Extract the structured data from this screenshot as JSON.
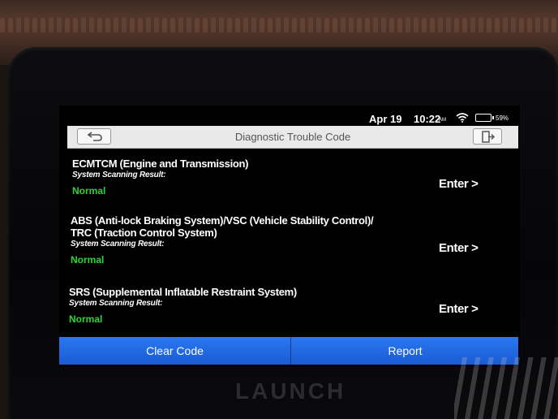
{
  "status_bar": {
    "date": "Apr 19",
    "time": "10:22",
    "time_suffix": "AM",
    "battery": "59%"
  },
  "header": {
    "title": "Diagnostic Trouble Code"
  },
  "systems": [
    {
      "name_lines": [
        "ECMTCM (Engine and Transmission)"
      ],
      "label": "System Scanning Result:",
      "result": "Normal",
      "action": "Enter >"
    },
    {
      "name_lines": [
        "ABS (Anti-lock Braking System)/VSC (Vehicle Stability Control)/",
        "TRC (Traction Control System)"
      ],
      "label": "System Scanning Result:",
      "result": "Normal",
      "action": "Enter >"
    },
    {
      "name_lines": [
        "SRS (Supplemental Inflatable Restraint System)"
      ],
      "label": "System Scanning Result:",
      "result": "Normal",
      "action": "Enter >"
    }
  ],
  "footer": {
    "clear_code": "Clear Code",
    "report": "Report"
  },
  "device": {
    "brand": "LAUNCH"
  },
  "colors": {
    "result_normal": "#2fd43a",
    "action_bar": "#2a78f0"
  }
}
